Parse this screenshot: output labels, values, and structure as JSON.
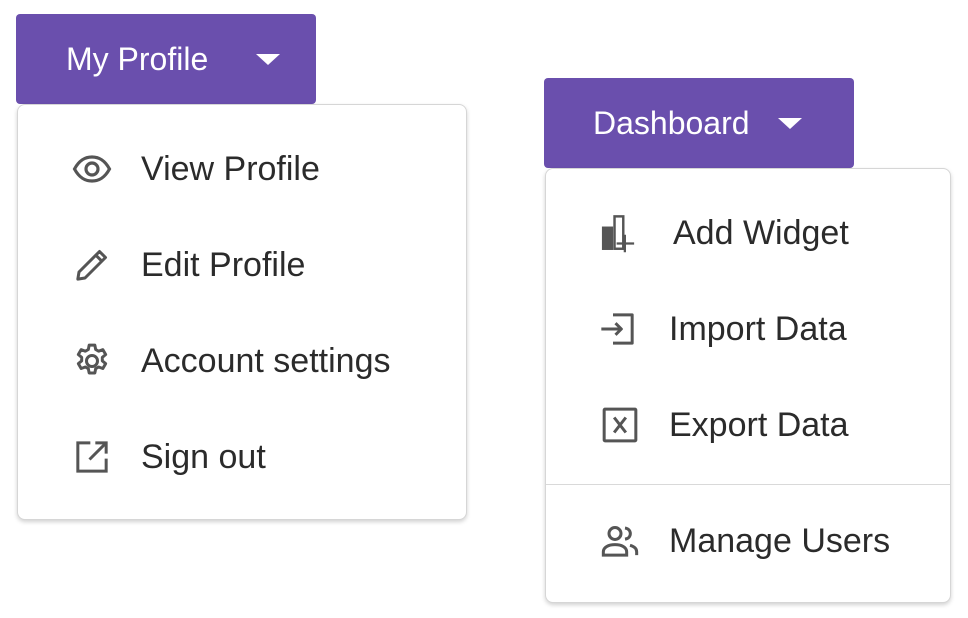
{
  "profile_menu": {
    "button_label": "My Profile",
    "caret_icon": "caret-down-icon",
    "items": [
      {
        "label": "View Profile",
        "icon": "eye-icon"
      },
      {
        "label": "Edit Profile",
        "icon": "pencil-icon"
      },
      {
        "label": "Account settings",
        "icon": "gear-icon"
      },
      {
        "label": "Sign out",
        "icon": "external-link-icon"
      }
    ]
  },
  "dashboard_menu": {
    "button_label": "Dashboard",
    "caret_icon": "caret-down-icon",
    "items": [
      {
        "label": "Add Widget",
        "icon": "add-widget-icon"
      },
      {
        "label": "Import Data",
        "icon": "import-icon"
      },
      {
        "label": "Export Data",
        "icon": "export-excel-icon"
      },
      {
        "label": "Manage Users",
        "icon": "users-icon"
      }
    ]
  },
  "colors": {
    "button_background": "#6a4fad",
    "button_text": "#ffffff",
    "menu_text": "#2b2b2b",
    "icon_color": "#555555"
  }
}
